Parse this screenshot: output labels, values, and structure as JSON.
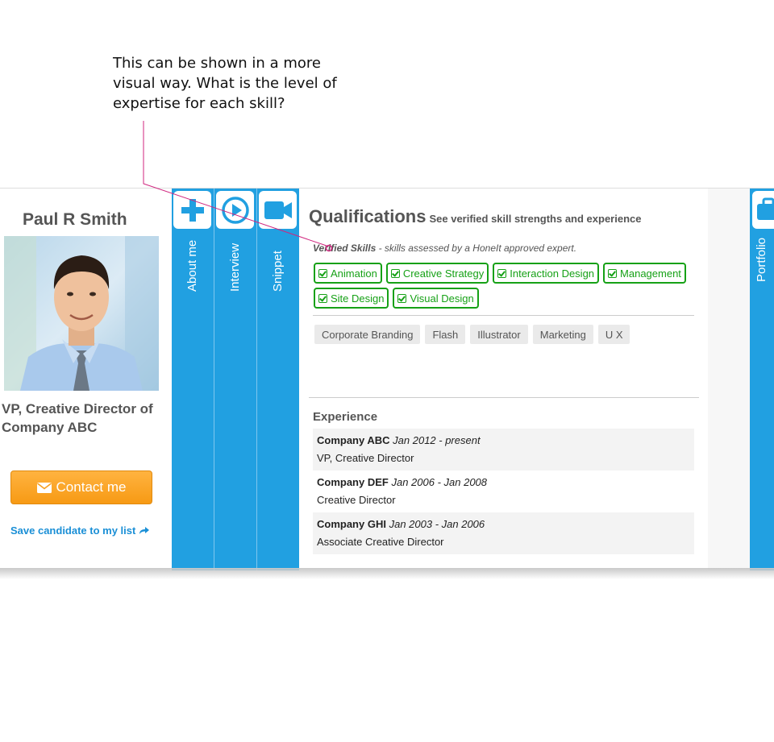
{
  "annotation": {
    "text": "This can be shown in a more visual way. What is the level of expertise for each skill?",
    "color": "#d0267f"
  },
  "profile": {
    "name": "Paul R Smith",
    "title": "VP, Creative Director of Company ABC",
    "contact_label": "Contact me",
    "save_label": "Save candidate to my list"
  },
  "tabs": [
    {
      "label": "About me",
      "icon": "plus-icon"
    },
    {
      "label": "Interview",
      "icon": "play-icon"
    },
    {
      "label": "Snippet",
      "icon": "video-camera-icon"
    }
  ],
  "portfolio_tab": {
    "label": "Portfolio",
    "icon": "briefcase-icon"
  },
  "qualifications": {
    "title": "Qualifications",
    "subtitle": "See verified skill strengths and experience",
    "verified_label": "Verified Skills",
    "verified_note": " - skills assessed by a HoneIt approved expert.",
    "verified_skills": [
      "Animation",
      "Creative Strategy",
      "Interaction Design",
      "Management",
      "Site Design",
      "Visual Design"
    ],
    "other_skills": [
      "Corporate Branding",
      "Flash",
      "Illustrator",
      "Marketing",
      "U X"
    ]
  },
  "experience": {
    "title": "Experience",
    "items": [
      {
        "company": "Company ABC",
        "dates": "Jan 2012 - present",
        "role": "VP, Creative Director"
      },
      {
        "company": "Company DEF",
        "dates": "Jan 2006 - Jan 2008",
        "role": "Creative Director"
      },
      {
        "company": "Company GHI",
        "dates": "Jan 2003 - Jan 2006",
        "role": "Associate Creative Director"
      }
    ]
  },
  "colors": {
    "tab_blue": "#21a0e1",
    "verified_green": "#16a116",
    "contact_orange": "#f7a021",
    "link_blue": "#1a8fd6"
  }
}
